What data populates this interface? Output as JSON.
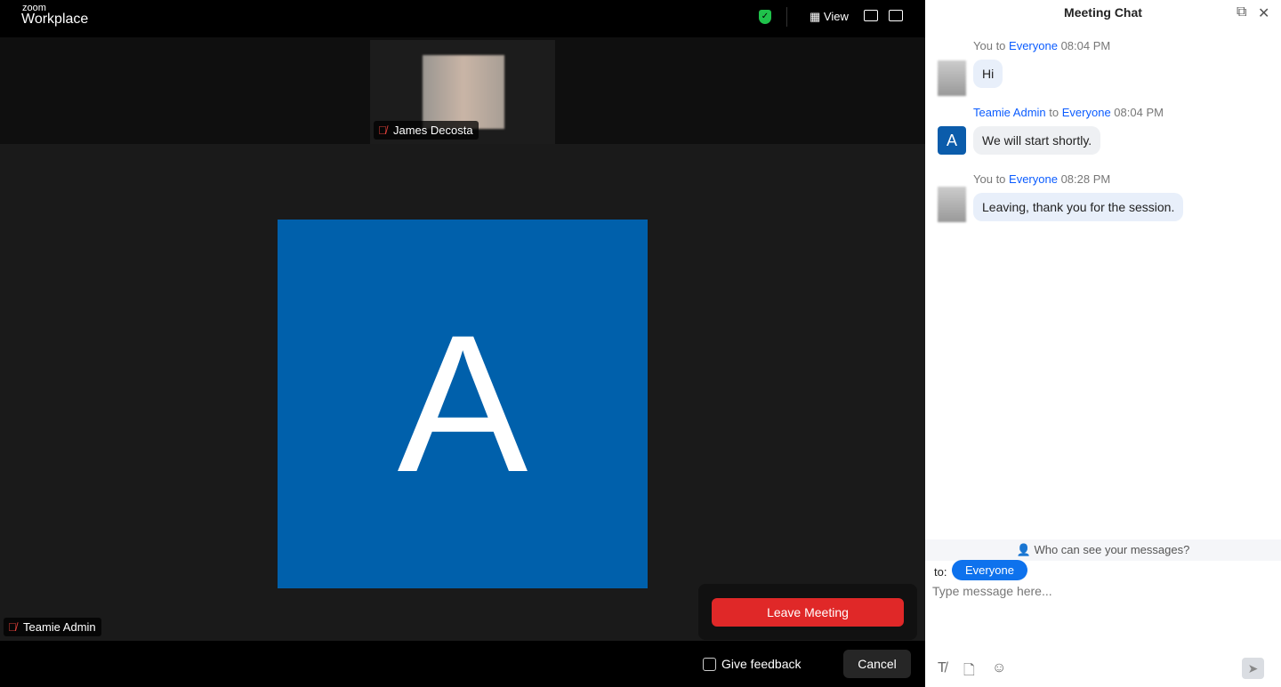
{
  "app": {
    "brand_small": "zoom",
    "brand": "Workplace",
    "view_label": "View"
  },
  "participants": {
    "top": "James Decosta",
    "main": "Teamie Admin",
    "main_initial": "A"
  },
  "leave": {
    "leave_label": "Leave Meeting",
    "feedback_label": "Give feedback",
    "feedback_checked": false,
    "cancel_label": "Cancel"
  },
  "chat": {
    "title": "Meeting Chat",
    "messages": [
      {
        "from": "You",
        "to_word": "to",
        "to": "Everyone",
        "time": "08:04 PM",
        "text": "Hi"
      },
      {
        "from": "Teamie Admin",
        "to_word": "to",
        "to": "Everyone",
        "time": "08:04 PM",
        "text": "We will start shortly.",
        "avatar": "A"
      },
      {
        "from": "You",
        "to_word": "to",
        "to": "Everyone",
        "time": "08:28 PM",
        "text": "Leaving, thank you for the session."
      }
    ],
    "visibility": "Who can see your messages?",
    "to_label": "to:",
    "recipient": "Everyone",
    "placeholder": "Type message here..."
  },
  "colors": {
    "accent": "#0e72ed",
    "leave": "#e02828",
    "avatar_bg": "#0060ab"
  }
}
